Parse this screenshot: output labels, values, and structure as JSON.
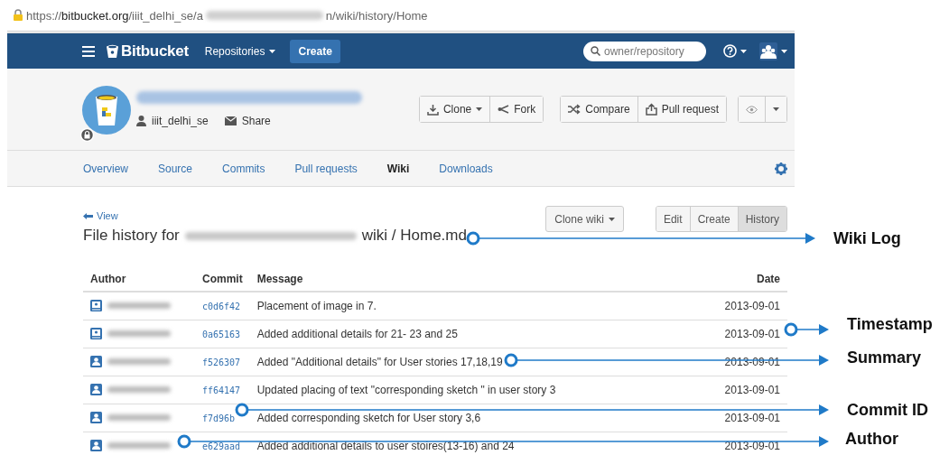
{
  "address_bar": {
    "scheme": "https://",
    "host": "bitbucket.org",
    "path_start": "/iiit_delhi_se/a",
    "path_end": "n/wiki/history/Home"
  },
  "nav": {
    "brand": "Bitbucket",
    "menu": "Repositories",
    "create": "Create",
    "search": {
      "placeholder": "owner/repository"
    }
  },
  "repo": {
    "owner": "iiit_delhi_se",
    "share": "Share",
    "private": true,
    "actions": [
      {
        "label": "Clone",
        "kind": "clone"
      },
      {
        "label": "Fork",
        "kind": "fork"
      },
      {
        "label": "Compare",
        "kind": "compare"
      },
      {
        "label": "Pull request",
        "kind": "pull"
      }
    ]
  },
  "tabs": [
    {
      "label": "Overview",
      "selected": false
    },
    {
      "label": "Source",
      "selected": false
    },
    {
      "label": "Commits",
      "selected": false
    },
    {
      "label": "Pull requests",
      "selected": false
    },
    {
      "label": "Wiki",
      "selected": true
    },
    {
      "label": "Downloads",
      "selected": false
    }
  ],
  "wiki": {
    "back": "View",
    "title_start": "File history for",
    "title_end": "wiki / Home.md",
    "clone": "Clone wiki",
    "modes": [
      {
        "label": "Edit",
        "selected": false
      },
      {
        "label": "Create",
        "selected": false
      },
      {
        "label": "History",
        "selected": true
      }
    ]
  },
  "table": {
    "columns": [
      "Author",
      "Commit",
      "Message",
      "Date"
    ],
    "rows": [
      {
        "kind": "team",
        "commit": "c0d6f42",
        "message": "Placement of image in 7.",
        "date": "2013-09-01"
      },
      {
        "kind": "team",
        "commit": "0a65163",
        "message": "Added additional details for 21- 23 and 25",
        "date": "2013-09-01"
      },
      {
        "kind": "user",
        "commit": "f526307",
        "message": "Added \"Additional details\" for User stories 17,18,19",
        "date": "2013-09-01"
      },
      {
        "kind": "user",
        "commit": "ff64147",
        "message": "Updated placing of text \"corresponding sketch \" in user story 3",
        "date": "2013-09-01"
      },
      {
        "kind": "user",
        "commit": "f7d96b",
        "message": "Added corresponding sketch for User story 3,6",
        "date": "2013-09-01"
      },
      {
        "kind": "user",
        "commit": "e629aad",
        "message": "Added additional details to user stoires(13-16) and 24",
        "date": "2013-09-01"
      }
    ]
  },
  "callouts": [
    {
      "label": "Wiki Log"
    },
    {
      "label": "Timestamp"
    },
    {
      "label": "Summary"
    },
    {
      "label": "Commit ID"
    },
    {
      "label": "Author"
    }
  ]
}
